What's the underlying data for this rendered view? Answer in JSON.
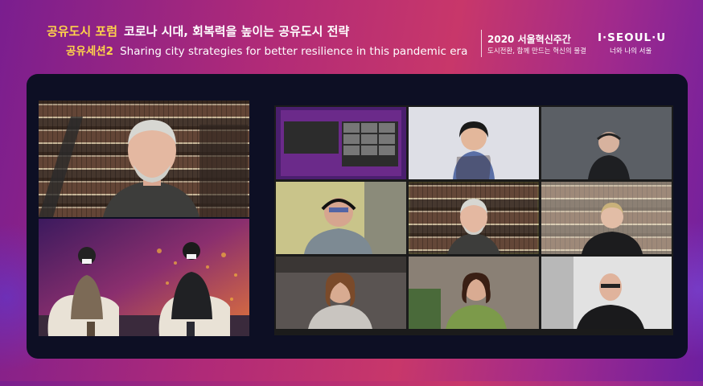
{
  "header": {
    "title_accent": "공유도시 포럼",
    "title": "코로나 시대, 회복력을 높이는 공유도시 전략",
    "sub_accent": "공유세션2",
    "sub": "Sharing city strategies for better resilience in this pandemic era",
    "event_title": "2020 서울혁신주간",
    "event_sub": "도시전환, 함께 만드는 혁신의 물결",
    "logo": "I·SEOUL·U",
    "logo_sub": "너와 나의 서울"
  },
  "colors": {
    "accent_yellow": "#ffd44a",
    "active_speaker_border": "#9be04b",
    "stage_bg": "#0d0f24"
  },
  "zoom_tiles": [
    {
      "id": "screen-share",
      "label": ""
    },
    {
      "id": "participant-2",
      "label": ""
    },
    {
      "id": "participant-3",
      "label": ""
    },
    {
      "id": "participant-4",
      "label": ""
    },
    {
      "id": "participant-5",
      "label": ""
    },
    {
      "id": "participant-6",
      "label": ""
    },
    {
      "id": "participant-7",
      "label": ""
    },
    {
      "id": "participant-8",
      "label": ""
    },
    {
      "id": "participant-9",
      "label": ""
    }
  ]
}
